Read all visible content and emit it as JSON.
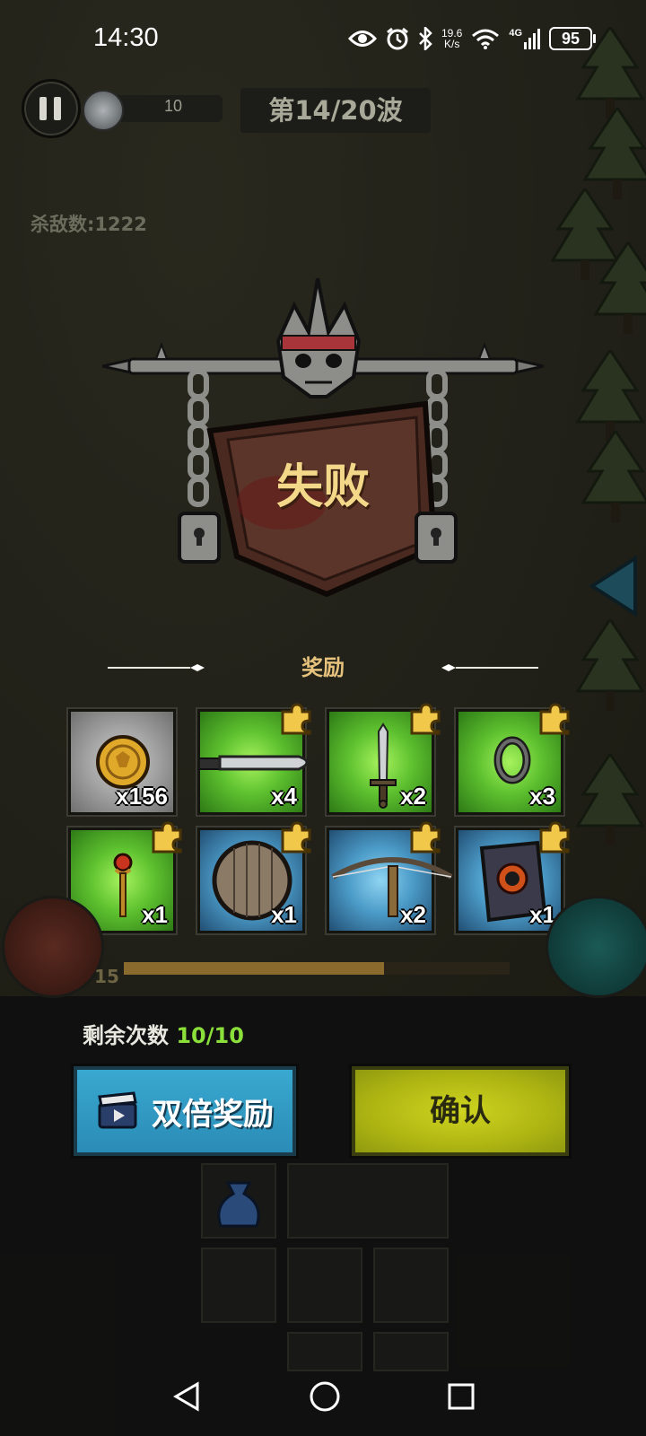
{
  "status_bar": {
    "time": "14:30",
    "net_speed_value": "19.6",
    "net_speed_unit": "K/s",
    "network_type": "4G",
    "battery": "95"
  },
  "hud": {
    "coin_count": "10",
    "wave": "第14/20波",
    "kill_count": "杀敌数:1222",
    "level": "15"
  },
  "result": {
    "title": "失败"
  },
  "rewards": {
    "label": "奖励",
    "items": [
      {
        "icon": "gold-coin-icon",
        "quantity": "x156",
        "rarity": "gray"
      },
      {
        "icon": "curved-blade-icon",
        "quantity": "x4",
        "rarity": "green"
      },
      {
        "icon": "sword-icon",
        "quantity": "x2",
        "rarity": "green"
      },
      {
        "icon": "ring-icon",
        "quantity": "x3",
        "rarity": "green"
      },
      {
        "icon": "scepter-icon",
        "quantity": "x1",
        "rarity": "green"
      },
      {
        "icon": "round-shield-icon",
        "quantity": "x1",
        "rarity": "blue"
      },
      {
        "icon": "crossbow-icon",
        "quantity": "x2",
        "rarity": "blue"
      },
      {
        "icon": "spellbook-icon",
        "quantity": "x1",
        "rarity": "blue"
      }
    ]
  },
  "bottom": {
    "remaining_label": "剩余次数",
    "remaining_value": "10/10",
    "double_reward_label": "双倍奖励",
    "confirm_label": "确认"
  },
  "colors": {
    "accent_gold": "#f3d88a",
    "remaining_green": "#8adf3a",
    "double_button": "#2a8cb6",
    "confirm_button": "#aeb512"
  }
}
